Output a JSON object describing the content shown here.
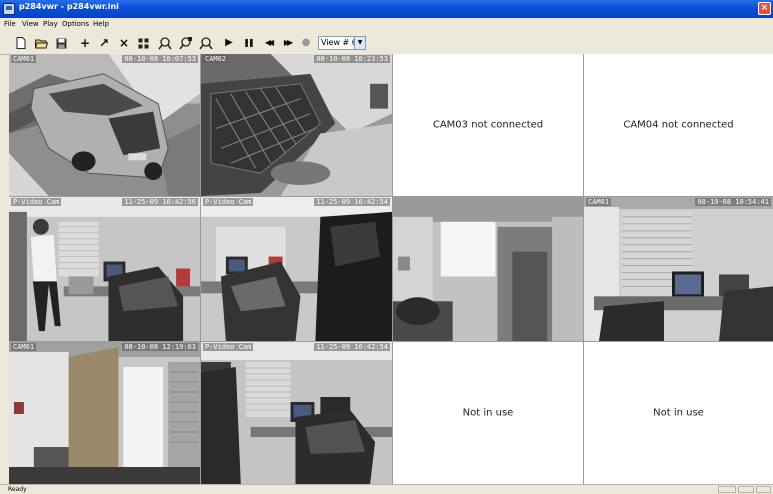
{
  "window": {
    "title": "p284vwr - p284vwr.ini",
    "close_label": "×"
  },
  "menu": [
    {
      "label": "File"
    },
    {
      "label": "View"
    },
    {
      "label": "Play"
    },
    {
      "label": "Options"
    },
    {
      "label": "Help"
    }
  ],
  "toolbar": {
    "buttons": [
      {
        "name": "new-file-icon",
        "glyph": ""
      },
      {
        "name": "open-folder-icon",
        "glyph": ""
      },
      {
        "name": "save-icon",
        "glyph": ""
      },
      {
        "name": "add-icon",
        "glyph": "+"
      },
      {
        "name": "arrow-icon",
        "glyph": "↗"
      },
      {
        "name": "delete-icon",
        "glyph": "×"
      },
      {
        "name": "grid-icon",
        "glyph": ""
      },
      {
        "name": "search-camera-icon",
        "glyph": ""
      },
      {
        "name": "search-record-icon",
        "glyph": ""
      },
      {
        "name": "search-playback-icon",
        "glyph": ""
      },
      {
        "name": "play-icon",
        "glyph": "▶"
      },
      {
        "name": "pause-icon",
        "glyph": "❚❚"
      },
      {
        "name": "rewind-icon",
        "glyph": "◀◀"
      },
      {
        "name": "fast-forward-icon",
        "glyph": "▶▶"
      },
      {
        "name": "record-icon",
        "glyph": "●"
      }
    ],
    "view_select": {
      "value": "View # 6"
    }
  },
  "cameras": [
    {
      "label": "CAM01",
      "time": "08-10-08 10:07:53",
      "message": "",
      "scene": "car"
    },
    {
      "label": "CAM02",
      "time": "08-10-08 10:23:53",
      "message": "",
      "scene": "bike"
    },
    {
      "label": "",
      "time": "",
      "message": "CAM03 not connected",
      "scene": ""
    },
    {
      "label": "",
      "time": "",
      "message": "CAM04 not connected",
      "scene": ""
    },
    {
      "label": "P-Video Cam",
      "time": "11-25-09 16:42:56",
      "message": "",
      "scene": "office-person"
    },
    {
      "label": "P-Video Cam",
      "time": "11-25-09 16:42:54",
      "message": "",
      "scene": "office-chair"
    },
    {
      "label": "",
      "time": "",
      "message": "",
      "scene": "doorway"
    },
    {
      "label": "CAM01",
      "time": "08-10-08 10:54:41",
      "message": "",
      "scene": "office-desk"
    },
    {
      "label": "CAM01",
      "time": "08-10-08 12:19:03",
      "message": "",
      "scene": "door-room"
    },
    {
      "label": "P-Video Cam",
      "time": "11-25-09 16:42:54",
      "message": "",
      "scene": "office-person2"
    },
    {
      "label": "",
      "time": "",
      "message": "Not in use",
      "scene": ""
    },
    {
      "label": "",
      "time": "",
      "message": "Not in use",
      "scene": ""
    }
  ],
  "status": {
    "text": "Ready"
  }
}
